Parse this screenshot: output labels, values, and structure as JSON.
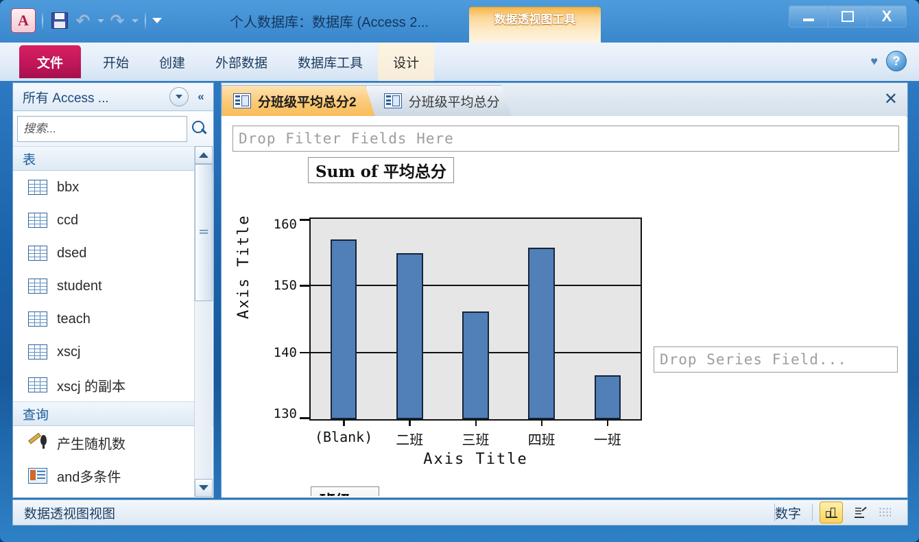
{
  "titlebar": {
    "document_title": "个人数据库：数据库 (Access 2...",
    "contextual_tab_group": "数据透视图工具",
    "qat": {
      "office_button": "A",
      "save": "save-icon",
      "undo": "↶",
      "redo": "↷",
      "customize": "customize-qat-icon"
    },
    "window_controls": {
      "minimize": "minimize",
      "maximize": "maximize",
      "close": "X"
    }
  },
  "ribbon": {
    "tabs": [
      {
        "label": "文件",
        "type": "file"
      },
      {
        "label": "开始",
        "type": "normal"
      },
      {
        "label": "创建",
        "type": "normal"
      },
      {
        "label": "外部数据",
        "type": "normal"
      },
      {
        "label": "数据库工具",
        "type": "normal"
      },
      {
        "label": "设计",
        "type": "contextual"
      }
    ],
    "help_label": "?",
    "minimize_ribbon": "♥"
  },
  "navpane": {
    "title": "所有 Access ...",
    "dropdown_icon": "chevron-down-icon",
    "collapse_icon": "«",
    "search": {
      "placeholder": "搜索...",
      "value": "",
      "icon": "search-icon"
    },
    "groups": [
      {
        "label": "表",
        "chevron": "⌃",
        "items": [
          {
            "label": "bbx",
            "icon": "table-icon"
          },
          {
            "label": "ccd",
            "icon": "table-icon"
          },
          {
            "label": "dsed",
            "icon": "table-icon"
          },
          {
            "label": "student",
            "icon": "table-icon"
          },
          {
            "label": "teach",
            "icon": "table-icon"
          },
          {
            "label": "xscj",
            "icon": "table-icon"
          },
          {
            "label": "xscj 的副本",
            "icon": "table-icon"
          }
        ]
      },
      {
        "label": "查询",
        "chevron": "⌃",
        "items": [
          {
            "label": "产生随机数",
            "icon": "query-parameter-icon"
          },
          {
            "label": "and多条件",
            "icon": "query-icon"
          }
        ]
      }
    ],
    "scroll": {
      "up": "▲",
      "down": "▼"
    }
  },
  "doctabs": {
    "tabs": [
      {
        "label": "分班级平均总分2",
        "active": true,
        "icon": "pivotchart-icon"
      },
      {
        "label": "分班级平均总分",
        "active": false,
        "icon": "pivottable-icon"
      }
    ],
    "close_label": "✕"
  },
  "chart_view": {
    "filter_dropzone": "Drop Filter Fields Here",
    "series_dropzone": "Drop Series Field...",
    "field_button": {
      "label": "班级",
      "caret": "▼"
    }
  },
  "chart_data": {
    "type": "bar",
    "title": "Sum of 平均总分",
    "categories": [
      "(Blank)",
      "二班",
      "三班",
      "四班",
      "一班"
    ],
    "values": [
      156.9,
      154.9,
      146.1,
      155.7,
      136.6
    ],
    "series": [
      {
        "name": "Sum of 平均总分",
        "values": [
          156.9,
          154.9,
          146.1,
          155.7,
          136.6
        ]
      }
    ],
    "xlabel": "Axis Title",
    "ylabel": "Axis Title",
    "ylim": [
      130,
      160
    ],
    "yticks": [
      130,
      140,
      150,
      160
    ],
    "grid": true,
    "legend": "none",
    "bar_color": "#5180b8",
    "plot_bg": "#e6e6e6"
  },
  "statusbar": {
    "view_text": "数据透视图视图",
    "mode_text": "数字",
    "buttons": [
      {
        "name": "pivotchart-view",
        "active": true
      },
      {
        "name": "pivottable-view",
        "active": false
      }
    ]
  }
}
